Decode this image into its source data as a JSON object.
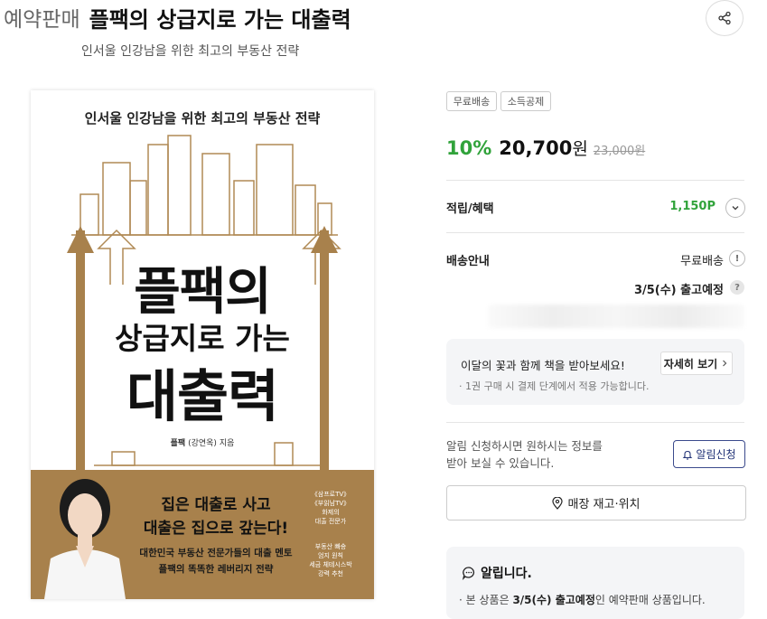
{
  "header": {
    "prefix": "예약판매",
    "title": "플팩의 상급지로 가는 대출력",
    "subtitle": "인서울 인강남을 위한 최고의 부동산 전략"
  },
  "cover": {
    "top_text": "인서울 인강남을 위한 최고의 부동산 전략",
    "title_line1": "플팩의",
    "title_line2": "상급지로 가는",
    "title_line3": "대출력",
    "author_name": "플팩",
    "author_realname": "(강연옥)",
    "author_suffix": "지음",
    "band_headline1": "집은 대출로 사고",
    "band_headline2": "대출은 집으로 갚는다!",
    "band_sub1": "대한민국 부동산 전문가들의 대출 멘토",
    "band_sub2": "플팩의 똑똑한 레버리지 전략",
    "laurel1_lines": [
      "《삼프로TV》",
      "《부읽남TV》",
      "화제의",
      "대출 전문가"
    ],
    "laurel2_lines": [
      "부동산 빠숑",
      "엄지 원칙",
      "세금 체테시스박",
      "강력 추천"
    ],
    "band_color": "#a8814c"
  },
  "badges": [
    "무료배송",
    "소득공제"
  ],
  "price": {
    "discount": "10%",
    "amount": "20,700",
    "unit": "원",
    "original": "23,000원",
    "accent_color": "#31a33b"
  },
  "points": {
    "label": "적립/혜택",
    "value": "1,150P"
  },
  "shipping": {
    "label": "배송안내",
    "value": "무료배송",
    "release": "3/5(수) 출고예정"
  },
  "promo": {
    "title": "이달의 꽃과 함께 책을 받아보세요!",
    "button": "자세히 보기",
    "note": "· 1권 구매 시 결제 단계에서 적용 가능합니다."
  },
  "alarm": {
    "text_line1": "알림 신청하시면 원하시는 정보를",
    "text_line2": "받아 보실 수 있습니다.",
    "button": "알림신청"
  },
  "store": {
    "button": "매장 재고·위치"
  },
  "notice": {
    "title": "알립니다.",
    "line_prefix": "본 상품은 ",
    "line_bold": "3/5(수) 출고예정",
    "line_suffix": "인 예약판매 상품입니다."
  }
}
